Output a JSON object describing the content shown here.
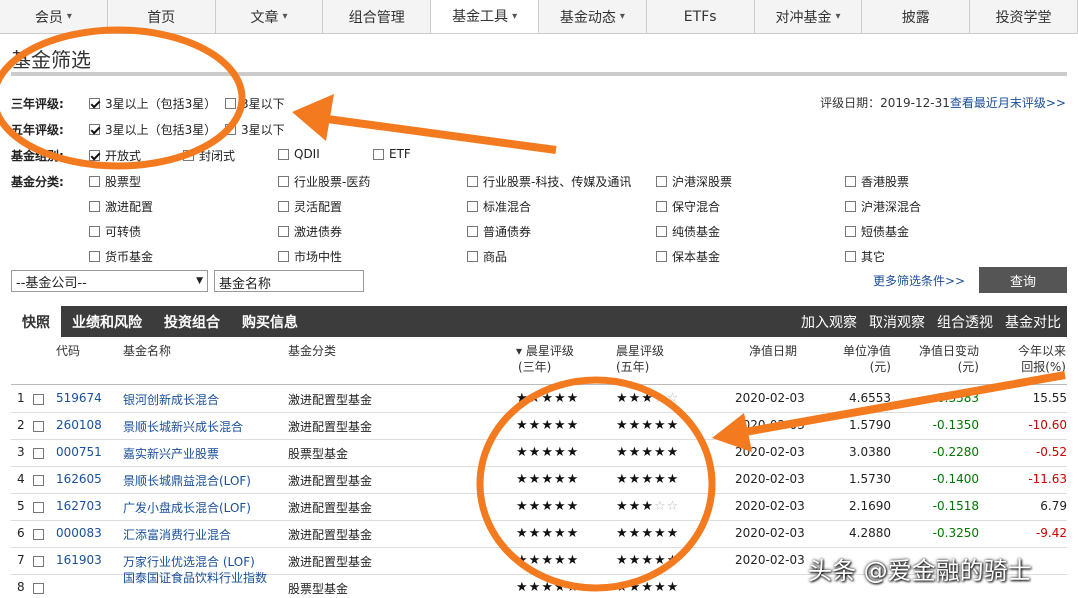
{
  "nav": [
    {
      "label": "会员",
      "caret": true
    },
    {
      "label": "首页",
      "caret": false
    },
    {
      "label": "文章",
      "caret": true
    },
    {
      "label": "组合管理",
      "caret": false
    },
    {
      "label": "基金工具",
      "caret": true,
      "active": true
    },
    {
      "label": "基金动态",
      "caret": true
    },
    {
      "label": "ETFs",
      "caret": false
    },
    {
      "label": "对冲基金",
      "caret": true
    },
    {
      "label": "披露",
      "caret": false
    },
    {
      "label": "投资学堂",
      "caret": false
    }
  ],
  "page_title": "基金筛选",
  "filters": {
    "three_year_label": "三年评级:",
    "five_year_label": "五年评级:",
    "group_label": "基金组别:",
    "category_label": "基金分类:",
    "rating_above": "3星以上（包括3星）",
    "rating_below": "3星以下",
    "groups": [
      "开放式",
      "封闭式",
      "QDII",
      "ETF"
    ],
    "categories": [
      [
        "股票型",
        "行业股票-医药",
        "行业股票-科技、传媒及通讯",
        "沪港深股票",
        "香港股票"
      ],
      [
        "激进配置",
        "灵活配置",
        "标准混合",
        "保守混合",
        "沪港深混合"
      ],
      [
        "可转债",
        "激进债券",
        "普通债券",
        "纯债基金",
        "短债基金"
      ],
      [
        "货币基金",
        "市场中性",
        "商品",
        "保本基金",
        "其它"
      ]
    ]
  },
  "rating_date": {
    "label": "评级日期：2019-12-31",
    "link": "查看最近月末评级>>"
  },
  "company_select": "--基金公司--",
  "name_input": "基金名称",
  "more_filters": "更多筛选条件>>",
  "query_button": "查询",
  "tabs": [
    "快照",
    "业绩和风险",
    "投资组合",
    "购买信息"
  ],
  "tab_actions": [
    "加入观察",
    "取消观察",
    "组合透视",
    "基金对比"
  ],
  "columns": {
    "code": "代码",
    "name": "基金名称",
    "category": "基金分类",
    "r3a": "▾ 晨星评级",
    "r3b": "(三年)",
    "r5a": "晨星评级",
    "r5b": "(五年)",
    "date": "净值日期",
    "nav_a": "单位净值",
    "nav_b": "(元)",
    "chg_a": "净值日变动",
    "chg_b": "(元)",
    "ytd_a": "今年以来",
    "ytd_b": "回报(%)"
  },
  "rows": [
    {
      "idx": "1",
      "code": "519674",
      "name": "银河创新成长混合",
      "cat": "激进配置型基金",
      "r3": 5,
      "r5": 3,
      "date": "2020-02-03",
      "nav": "4.6553",
      "chg": "0.3583",
      "ytd": "15.55"
    },
    {
      "idx": "2",
      "code": "260108",
      "name": "景顺长城新兴成长混合",
      "cat": "激进配置型基金",
      "r3": 5,
      "r5": 5,
      "date": "2020-02-03",
      "nav": "1.5790",
      "chg": "-0.1350",
      "ytd": "-10.60"
    },
    {
      "idx": "3",
      "code": "000751",
      "name": "嘉实新兴产业股票",
      "cat": "股票型基金",
      "r3": 5,
      "r5": 5,
      "date": "2020-02-03",
      "nav": "3.0380",
      "chg": "-0.2280",
      "ytd": "-0.52"
    },
    {
      "idx": "4",
      "code": "162605",
      "name": "景顺长城鼎益混合(LOF)",
      "cat": "激进配置型基金",
      "r3": 5,
      "r5": 5,
      "date": "2020-02-03",
      "nav": "1.5730",
      "chg": "-0.1400",
      "ytd": "-11.63"
    },
    {
      "idx": "5",
      "code": "162703",
      "name": "广发小盘成长混合(LOF)",
      "cat": "激进配置型基金",
      "r3": 5,
      "r5": 3,
      "date": "2020-02-03",
      "nav": "2.1690",
      "chg": "-0.1518",
      "ytd": "6.79"
    },
    {
      "idx": "6",
      "code": "000083",
      "name": "汇添富消费行业混合",
      "cat": "激进配置型基金",
      "r3": 5,
      "r5": 5,
      "date": "2020-02-03",
      "nav": "4.2880",
      "chg": "-0.3250",
      "ytd": "-9.42"
    },
    {
      "idx": "7",
      "code": "161903",
      "name": "万家行业优选混合 (LOF)",
      "cat": "激进配置型基金",
      "r3": 5,
      "r5": 5,
      "date": "2020-02-03",
      "nav": "",
      "chg": "",
      "ytd": ""
    },
    {
      "idx": "8",
      "code": "",
      "name": "国泰国证食品饮料行业指数",
      "cat": "股票型基金",
      "r3": 5,
      "r5": 5,
      "date": "",
      "nav": "",
      "chg": "",
      "ytd": ""
    }
  ],
  "watermark": "头条 @爱金融的骑士",
  "colors": {
    "annotation": "#f47a20",
    "link": "#1a4f99",
    "tabbar": "#3c3c3c"
  }
}
